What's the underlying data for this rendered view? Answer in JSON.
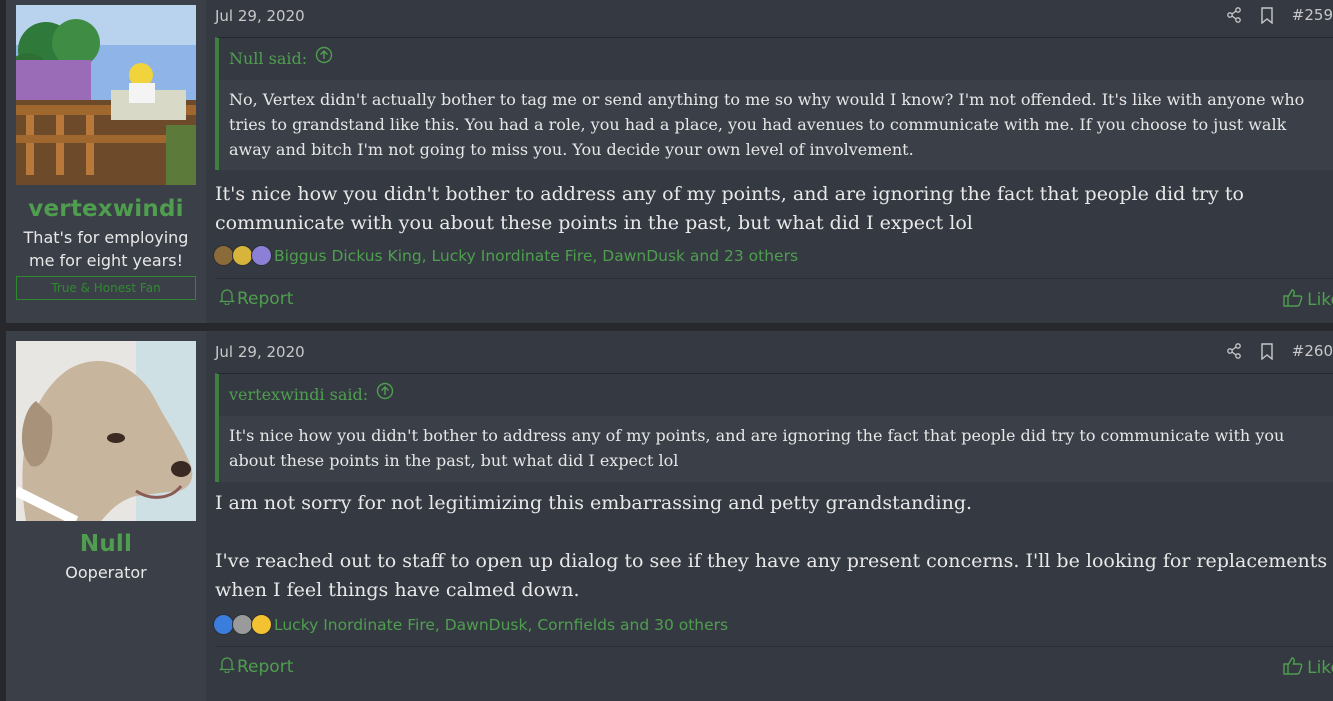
{
  "posts": [
    {
      "user": {
        "name": "vertexwindi",
        "title": "That's for employing me for eight years!",
        "banner": "True & Honest Fan",
        "avatar": "cartoon-man-on-porch-avatar"
      },
      "date": "Jul 29, 2020",
      "post_number": "#259",
      "quote": {
        "author_line": "Null said:",
        "text": "No, Vertex didn't actually bother to tag me or send anything to me so why would I know? I'm not offended. It's like with anyone who tries to grandstand like this. You had a role, you had a place, you had avenues to communicate with me. If you choose to just walk away and bitch I'm not going to miss you. You decide your own level of involvement."
      },
      "message": [
        "It's nice how you didn't bother to address any of my points, and are ignoring the fact that people did try to communicate with you about these points in the past, but what did I expect lol"
      ],
      "reactions": "Biggus Dickus King, Lucky Inordinate Fire, DawnDusk and 23 others",
      "report_label": "Report",
      "like_label": "Like"
    },
    {
      "user": {
        "name": "Null",
        "title": "Ooperator",
        "avatar": "cartoon-dog-avatar"
      },
      "date": "Jul 29, 2020",
      "post_number": "#260",
      "quote": {
        "author_line": "vertexwindi said:",
        "text": "It's nice how you didn't bother to address any of my points, and are ignoring the fact that people did try to communicate with you about these points in the past, but what did I expect lol"
      },
      "message": [
        "I am not sorry for not legitimizing this embarrassing and petty grandstanding.",
        "I've reached out to staff to open up dialog to see if they have any present concerns. I'll be looking for replacements when I feel things have calmed down."
      ],
      "reactions": "Lucky Inordinate Fire, DawnDusk, Cornfields and 30 others",
      "report_label": "Report",
      "like_label": "Like"
    }
  ],
  "icons": {
    "share": "share-icon",
    "bookmark": "bookmark-icon",
    "report": "bell-icon",
    "like": "thumbs-up-icon",
    "quote_jump": "arrow-up-circle-icon"
  },
  "colors": {
    "accent": "#4f9e4f",
    "post_bg": "#353a42",
    "user_bg": "#3b4048",
    "page_bg": "#26282c"
  }
}
